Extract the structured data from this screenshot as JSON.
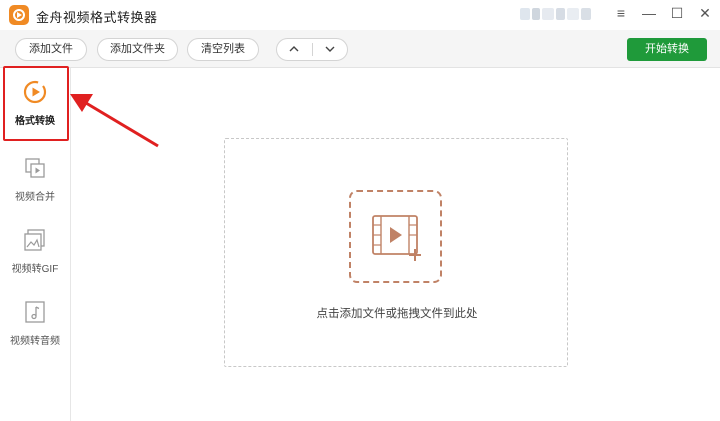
{
  "app": {
    "title": "金舟视频格式转换器"
  },
  "toolbar": {
    "add_file": "添加文件",
    "add_folder": "添加文件夹",
    "clear_list": "清空列表",
    "move_up": "^",
    "move_down": "v",
    "start": "开始转换"
  },
  "window_controls": {
    "menu": "≡",
    "minimize": "—",
    "maximize": "☐",
    "close": "✕"
  },
  "sidebar": {
    "items": [
      {
        "label": "格式转换",
        "icon": "format-convert-icon",
        "active": true
      },
      {
        "label": "视频合并",
        "icon": "video-merge-icon",
        "active": false
      },
      {
        "label": "视频转GIF",
        "icon": "video-to-gif-icon",
        "active": false
      },
      {
        "label": "视频转音频",
        "icon": "video-to-audio-icon",
        "active": false
      }
    ]
  },
  "dropzone": {
    "hint": "点击添加文件或拖拽文件到此处",
    "icon": "add-video-icon"
  },
  "colors": {
    "accent": "#f08a24",
    "start_green": "#1f9a3a",
    "highlight_red": "#e02020",
    "drop_icon": "#c08266"
  }
}
